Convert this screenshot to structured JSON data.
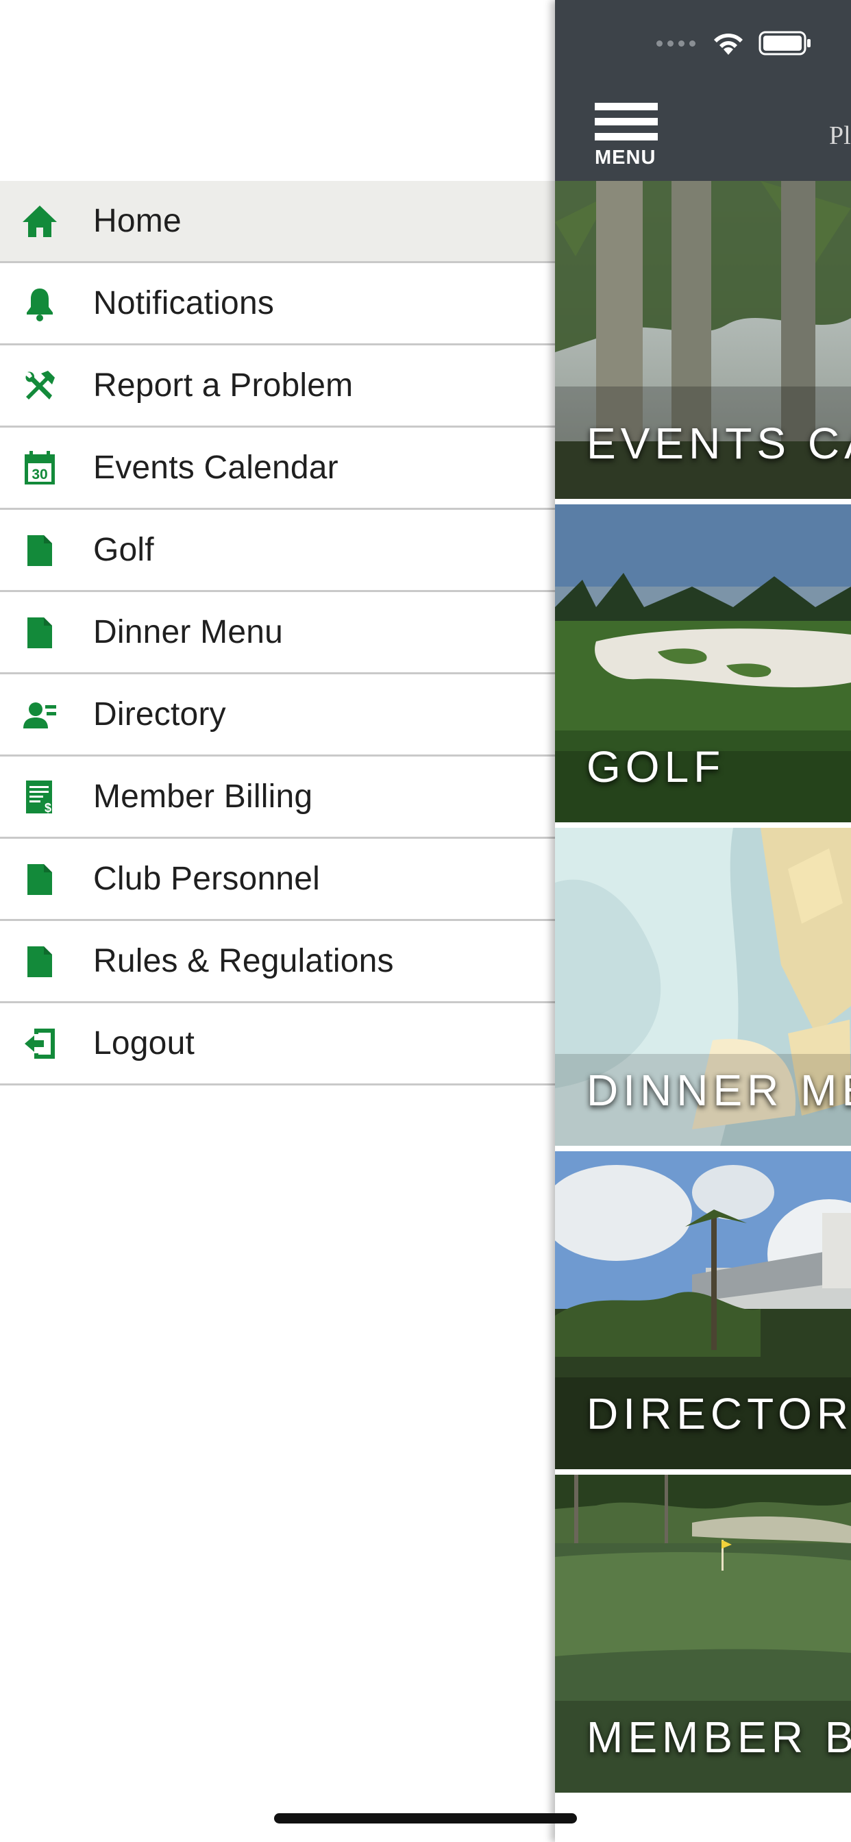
{
  "menu": {
    "items": [
      {
        "label": "Home",
        "icon": "home-icon",
        "active": true
      },
      {
        "label": "Notifications",
        "icon": "bell-icon"
      },
      {
        "label": "Report a Problem",
        "icon": "tools-icon"
      },
      {
        "label": "Events Calendar",
        "icon": "calendar-icon"
      },
      {
        "label": "Golf",
        "icon": "document-icon"
      },
      {
        "label": "Dinner Menu",
        "icon": "document-icon"
      },
      {
        "label": "Directory",
        "icon": "person-icon"
      },
      {
        "label": "Member Billing",
        "icon": "billing-icon"
      },
      {
        "label": "Club Personnel",
        "icon": "document-icon"
      },
      {
        "label": "Rules & Regulations",
        "icon": "document-icon"
      },
      {
        "label": "Logout",
        "icon": "logout-icon"
      }
    ]
  },
  "header": {
    "menu_label": "MENU",
    "brand_partial": "Pl"
  },
  "calendar_icon_day": "30",
  "tiles": [
    {
      "label": "EVENTS CA"
    },
    {
      "label": "GOLF"
    },
    {
      "label": "DINNER ME"
    },
    {
      "label": "DIRECTORY"
    },
    {
      "label": "MEMBER B"
    }
  ],
  "colors": {
    "accent_green": "#138a3a",
    "header_bg": "#3d4349",
    "active_row_bg": "#ededea",
    "divider": "#c9c9c9"
  }
}
